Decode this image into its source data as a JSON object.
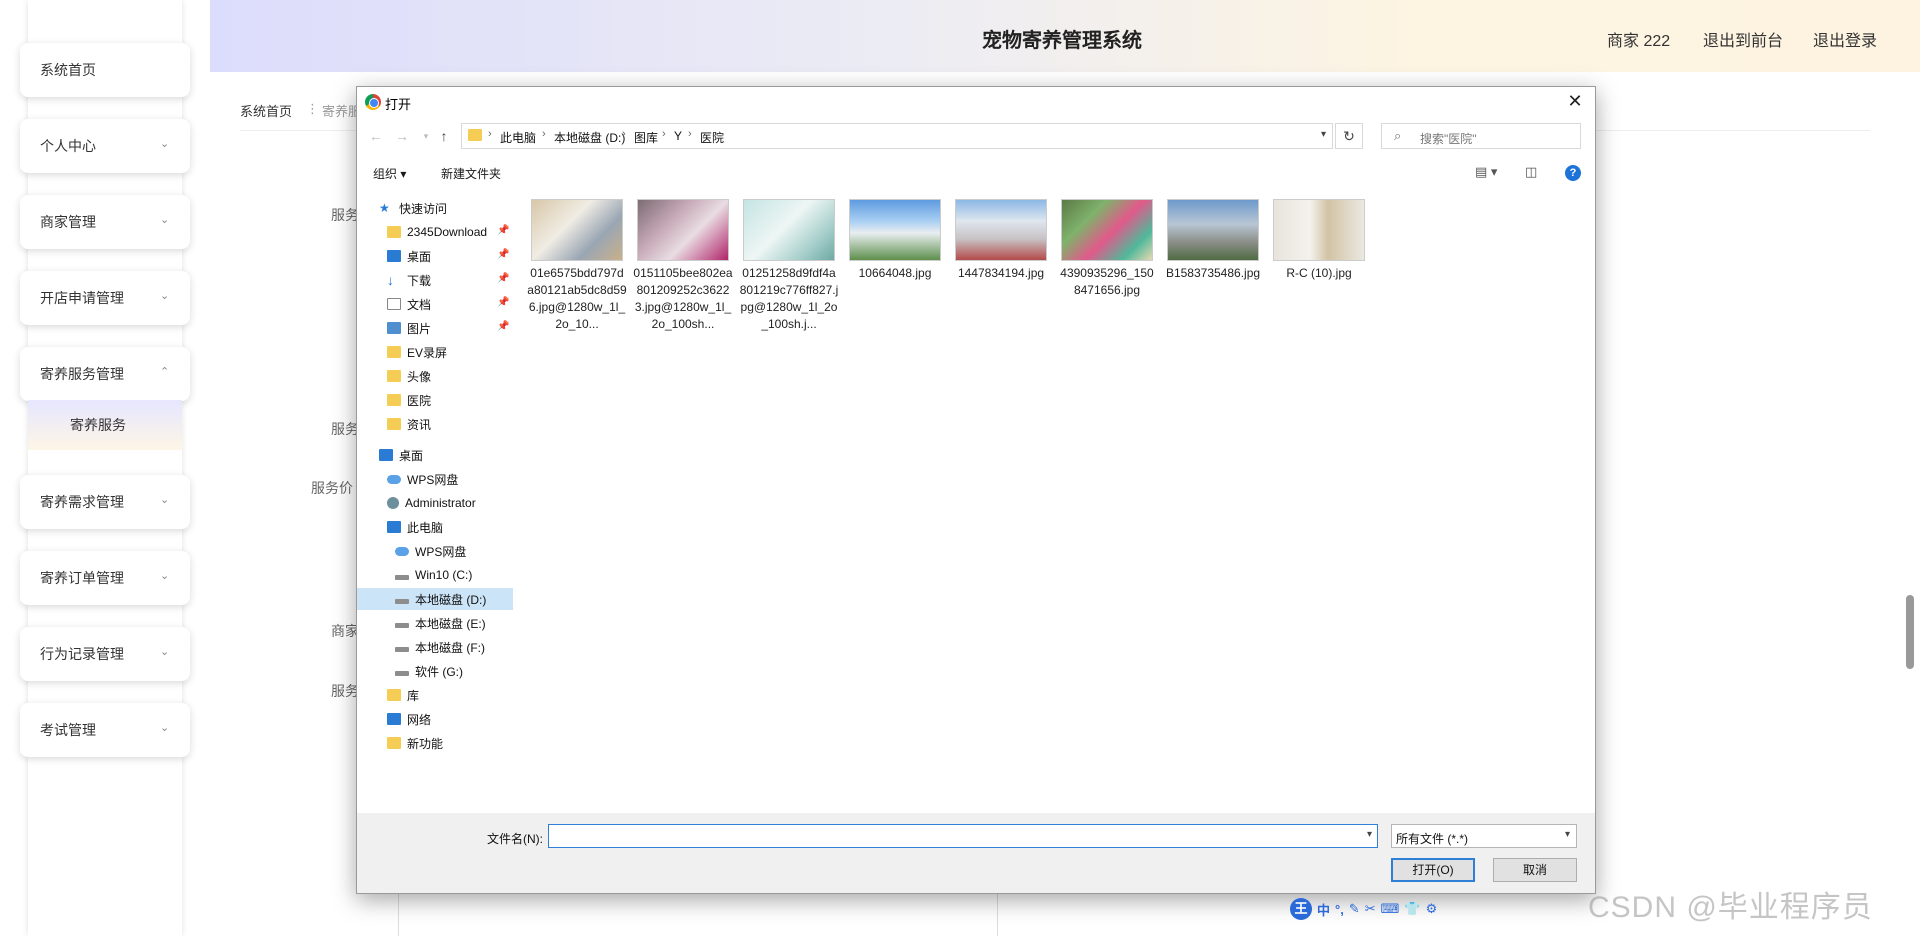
{
  "header": {
    "title": "宠物寄养管理系统",
    "user": "商家 222",
    "link_front": "退出到前台",
    "link_logout": "退出登录"
  },
  "sidebar": {
    "items": [
      {
        "label": "系统首页"
      },
      {
        "label": "个人中心"
      },
      {
        "label": "商家管理"
      },
      {
        "label": "开店申请管理"
      },
      {
        "label": "寄养服务管理"
      },
      {
        "label": "寄养需求管理"
      },
      {
        "label": "寄养订单管理"
      },
      {
        "label": "行为记录管理"
      },
      {
        "label": "考试管理"
      }
    ],
    "submenu": "寄养服务"
  },
  "page": {
    "breadcrumb_home": "系统首页",
    "breadcrumb_sep": "⋮",
    "breadcrumb_current": "寄养服",
    "labels": [
      "服务",
      "服务",
      "服务价",
      "商家",
      "服务"
    ]
  },
  "dialog": {
    "title": "打开",
    "path": [
      "此电脑",
      "本地磁盘 (D:)",
      "图库",
      "Y",
      "医院"
    ],
    "search_placeholder": "搜索\"医院\"",
    "toolbar": {
      "organize": "组织 ▾",
      "new_folder": "新建文件夹"
    },
    "nav": [
      {
        "label": "快速访问",
        "icon": "star-icon"
      },
      {
        "label": "2345Download",
        "icon": "folder-icon"
      },
      {
        "label": "桌面",
        "icon": "desktop-icon"
      },
      {
        "label": "下载",
        "icon": "download-icon"
      },
      {
        "label": "文档",
        "icon": "document-icon"
      },
      {
        "label": "图片",
        "icon": "picture-icon"
      },
      {
        "label": "EV录屏",
        "icon": "folder-icon"
      },
      {
        "label": "头像",
        "icon": "folder-icon"
      },
      {
        "label": "医院",
        "icon": "folder-icon"
      },
      {
        "label": "资讯",
        "icon": "folder-icon"
      },
      {
        "label": "桌面",
        "icon": "desktop-icon"
      },
      {
        "label": "WPS网盘",
        "icon": "cloud-icon"
      },
      {
        "label": "Administrator",
        "icon": "user-icon"
      },
      {
        "label": "此电脑",
        "icon": "computer-icon"
      },
      {
        "label": "WPS网盘",
        "icon": "cloud-icon"
      },
      {
        "label": "Win10 (C:)",
        "icon": "drive-icon"
      },
      {
        "label": "本地磁盘 (D:)",
        "icon": "drive-icon"
      },
      {
        "label": "本地磁盘 (E:)",
        "icon": "drive-icon"
      },
      {
        "label": "本地磁盘 (F:)",
        "icon": "drive-icon"
      },
      {
        "label": "软件 (G:)",
        "icon": "drive-icon"
      },
      {
        "label": "库",
        "icon": "library-icon"
      },
      {
        "label": "网络",
        "icon": "network-icon"
      },
      {
        "label": "新功能",
        "icon": "folder-icon"
      }
    ],
    "files": [
      {
        "name": "01e6575bdd797da80121ab5dc8d596.jpg@1280w_1l_2o_10..."
      },
      {
        "name": "0151105bee802ea801209252c36223.jpg@1280w_1l_2o_100sh..."
      },
      {
        "name": "01251258d9fdf4a801219c776ff827.jpg@1280w_1l_2o_100sh.j..."
      },
      {
        "name": "10664048.jpg"
      },
      {
        "name": "1447834194.jpg"
      },
      {
        "name": "4390935296_1508471656.jpg"
      },
      {
        "name": "B1583735486.jpg"
      },
      {
        "name": "R-C (10).jpg"
      }
    ],
    "filename_label": "文件名(N):",
    "filename_value": "",
    "filter": "所有文件 (*.*)",
    "open_button": "打开(O)",
    "cancel_button": "取消"
  },
  "ime": {
    "logo": "王",
    "mode": "中",
    "punct": "°,"
  },
  "watermark": "CSDN @毕业程序员"
}
